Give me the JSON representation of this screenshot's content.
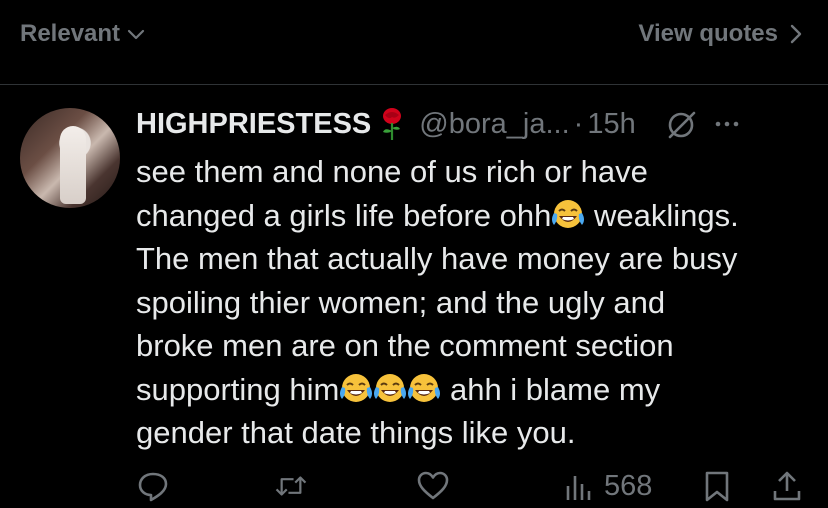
{
  "top_bar": {
    "sort_label": "Relevant",
    "view_quotes_label": "View quotes"
  },
  "tweet": {
    "author_name": "HIGHPRIESTESS",
    "author_handle": "@bora_ja...",
    "separator": "·",
    "timestamp": "15h",
    "lines": [
      {
        "before": "see them and none of us rich or have",
        "emojis": 0,
        "after": ""
      },
      {
        "before": "changed a girls life before ohh",
        "emojis": 1,
        "after": " weaklings."
      },
      {
        "before": "The men that actually have money are busy",
        "emojis": 0,
        "after": ""
      },
      {
        "before": "spoiling thier women; and the ugly and",
        "emojis": 0,
        "after": ""
      },
      {
        "before": "broke men are on the comment section",
        "emojis": 0,
        "after": ""
      },
      {
        "before": "supporting him",
        "emojis": 3,
        "after": " ahh i blame my"
      },
      {
        "before": "gender that date things like you.",
        "emojis": 0,
        "after": ""
      }
    ],
    "emoji_name": "face-with-tears-of-joy",
    "views_count": "568"
  },
  "icons": {
    "author_badge": "rose-icon",
    "grok": "grok-icon",
    "more": "more-icon",
    "reply": "reply-icon",
    "retweet": "retweet-icon",
    "like": "like-icon",
    "views": "views-icon",
    "bookmark": "bookmark-icon",
    "share": "share-icon"
  },
  "colors": {
    "background": "#000000",
    "text": "#e7e9ea",
    "secondary": "#71767b",
    "rose": "#d0021b"
  }
}
